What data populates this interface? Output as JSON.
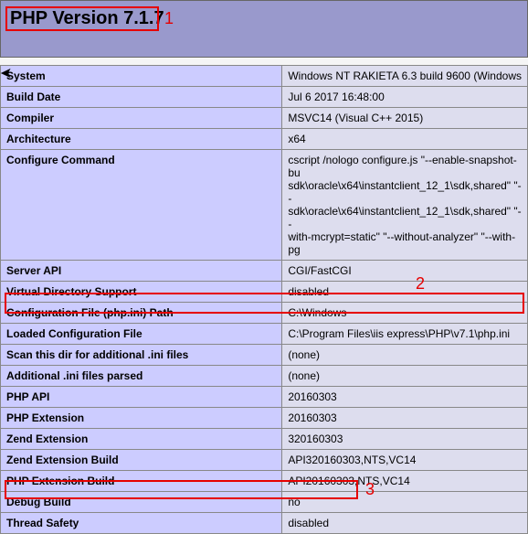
{
  "header_title": "PHP Version 7.1.7",
  "annotations": {
    "one": "1",
    "two": "2",
    "three": "3"
  },
  "rows": [
    {
      "key": "System",
      "val": "Windows NT RAKIETA 6.3 build 9600 (Windows"
    },
    {
      "key": "Build Date",
      "val": "Jul 6 2017 16:48:00"
    },
    {
      "key": "Compiler",
      "val": "MSVC14 (Visual C++ 2015)"
    },
    {
      "key": "Architecture",
      "val": "x64"
    },
    {
      "key": "Configure Command",
      "val": "cscript /nologo configure.js \"--enable-snapshot-bu\nsdk\\oracle\\x64\\instantclient_12_1\\sdk,shared\" \"--\nsdk\\oracle\\x64\\instantclient_12_1\\sdk,shared\" \"--\nwith-mcrypt=static\" \"--without-analyzer\" \"--with-pg"
    },
    {
      "key": "Server API",
      "val": "CGI/FastCGI"
    },
    {
      "key": "Virtual Directory Support",
      "val": "disabled"
    },
    {
      "key": "Configuration File (php.ini) Path",
      "val": "C:\\Windows"
    },
    {
      "key": "Loaded Configuration File",
      "val": "C:\\Program Files\\iis express\\PHP\\v7.1\\php.ini"
    },
    {
      "key": "Scan this dir for additional .ini files",
      "val": "(none)"
    },
    {
      "key": "Additional .ini files parsed",
      "val": "(none)"
    },
    {
      "key": "PHP API",
      "val": "20160303"
    },
    {
      "key": "PHP Extension",
      "val": "20160303"
    },
    {
      "key": "Zend Extension",
      "val": "320160303"
    },
    {
      "key": "Zend Extension Build",
      "val": "API320160303,NTS,VC14"
    },
    {
      "key": "PHP Extension Build",
      "val": "API20160303,NTS,VC14"
    },
    {
      "key": "Debug Build",
      "val": "no"
    },
    {
      "key": "Thread Safety",
      "val": "disabled"
    }
  ]
}
